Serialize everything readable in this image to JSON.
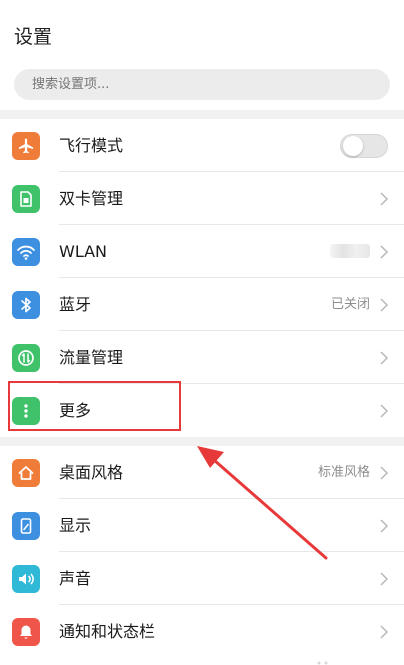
{
  "header": {
    "title": "设置"
  },
  "search": {
    "placeholder": "搜索设置项..."
  },
  "group1": [
    {
      "label": "飞行模式",
      "icon": "airplane-icon",
      "color": "#f07c3a",
      "control": "toggle",
      "toggle_on": false
    },
    {
      "label": "双卡管理",
      "icon": "sim-card-icon",
      "color": "#3fc26a",
      "control": "chevron"
    },
    {
      "label": "WLAN",
      "icon": "wifi-icon",
      "color": "#3d8fe0",
      "control": "chevron"
    },
    {
      "label": "蓝牙",
      "icon": "bluetooth-icon",
      "color": "#3d8fe0",
      "value": "已关闭",
      "control": "chevron"
    },
    {
      "label": "流量管理",
      "icon": "data-usage-icon",
      "color": "#3fc26a",
      "control": "chevron"
    },
    {
      "label": "更多",
      "icon": "more-vertical-icon",
      "color": "#3fc26a",
      "control": "chevron"
    }
  ],
  "group2": [
    {
      "label": "桌面风格",
      "icon": "home-icon",
      "color": "#f07c3a",
      "value": "标准风格",
      "control": "chevron"
    },
    {
      "label": "显示",
      "icon": "display-icon",
      "color": "#3d8fe0",
      "control": "chevron"
    },
    {
      "label": "声音",
      "icon": "speaker-icon",
      "color": "#2fb9d6",
      "control": "chevron"
    },
    {
      "label": "通知和状态栏",
      "icon": "bell-icon",
      "color": "#f0554a",
      "control": "chevron"
    }
  ],
  "annotation": {
    "color": "#e8393a"
  }
}
